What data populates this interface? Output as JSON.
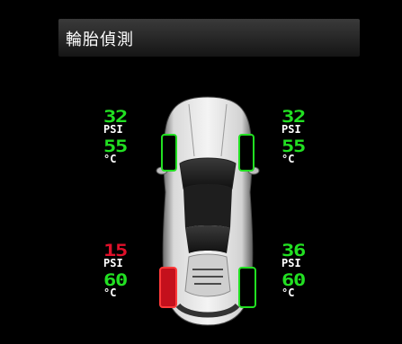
{
  "title": "輪胎偵測",
  "colors": {
    "ok": "#22e022",
    "warn": "#e0102a",
    "unit": "#ffffff"
  },
  "tires": {
    "front_left": {
      "pressure": "32",
      "pressure_unit": "PSI",
      "temp": "55",
      "temp_unit": "°C",
      "status": "ok"
    },
    "front_right": {
      "pressure": "32",
      "pressure_unit": "PSI",
      "temp": "55",
      "temp_unit": "°C",
      "status": "ok"
    },
    "rear_left": {
      "pressure": "15",
      "pressure_unit": "PSI",
      "temp": "60",
      "temp_unit": "°C",
      "status": "warn"
    },
    "rear_right": {
      "pressure": "36",
      "pressure_unit": "PSI",
      "temp": "60",
      "temp_unit": "°C",
      "status": "ok"
    }
  }
}
